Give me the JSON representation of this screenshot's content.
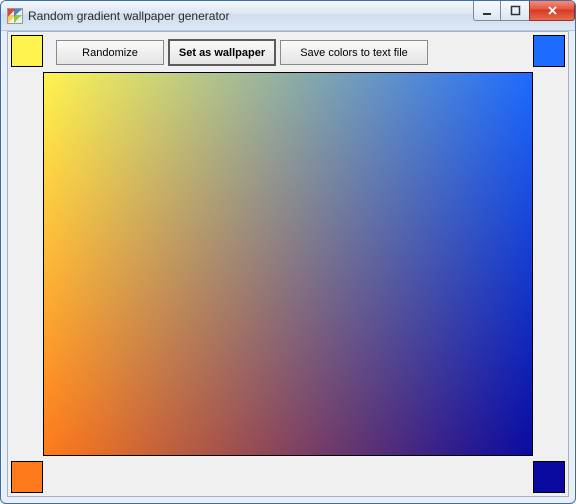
{
  "window": {
    "title": "Random gradient wallpaper generator"
  },
  "buttons": {
    "randomize": "Randomize",
    "set_wallpaper": "Set as wallpaper",
    "save_colors": "Save colors to text file"
  },
  "corners": {
    "top_left": "#fff44f",
    "top_right": "#1e6bff",
    "bottom_left": "#ff7a1a",
    "bottom_right": "#0a0aa0"
  }
}
